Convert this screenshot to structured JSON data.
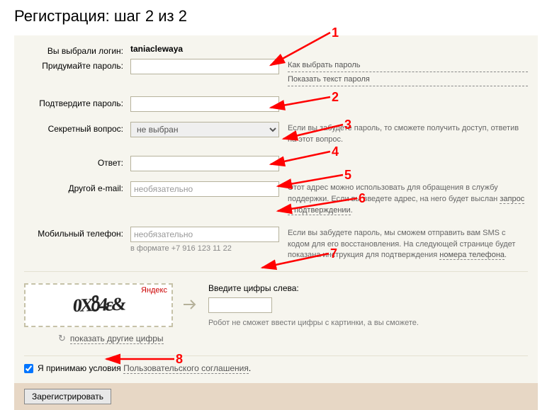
{
  "title": "Регистрация: шаг 2 из 2",
  "login_row": {
    "label": "Вы выбрали логин:",
    "value": "taniaclewaya"
  },
  "password": {
    "label": "Придумайте пароль:",
    "link_howto": "Как выбрать пароль",
    "link_show": "Показать текст пароля"
  },
  "password_confirm": {
    "label": "Подтвердите пароль:"
  },
  "secret": {
    "label": "Секретный вопрос:",
    "selected": "не выбран",
    "hint": "Если вы забудете пароль, то сможете получить доступ, ответив на этот вопрос."
  },
  "answer": {
    "label": "Ответ:"
  },
  "email": {
    "label": "Другой e-mail:",
    "placeholder": "необязательно",
    "hint_before": "Этот адрес можно использовать для обращения в службу поддержки. Если вы введете адрес, на него будет выслан ",
    "hint_link": "запрос о подтверждении",
    "hint_after": "."
  },
  "phone": {
    "label": "Мобильный телефон:",
    "placeholder": "необязательно",
    "format_note": "в формате +7 916 123 11 22",
    "hint_before": "Если вы забудете пароль, мы сможем отправить вам SMS с кодом для его восстановления. На следующей странице будет показана инструкция для подтверждения ",
    "hint_link": "номера телефона",
    "hint_after": "."
  },
  "captcha": {
    "brand": "Яндекс",
    "label": "Введите цифры слева:",
    "note": "Робот не сможет ввести цифры с картинки, а вы сможете.",
    "refresh": "показать другие цифры"
  },
  "agree": {
    "text_before": "Я принимаю условия ",
    "link": "Пользовательского соглашения",
    "text_after": "."
  },
  "submit": {
    "label": "Зарегистрировать"
  },
  "annotations": {
    "n1": "1",
    "n2": "2",
    "n3": "3",
    "n4": "4",
    "n5": "5",
    "n6": "6",
    "n7": "7",
    "n8": "8"
  }
}
